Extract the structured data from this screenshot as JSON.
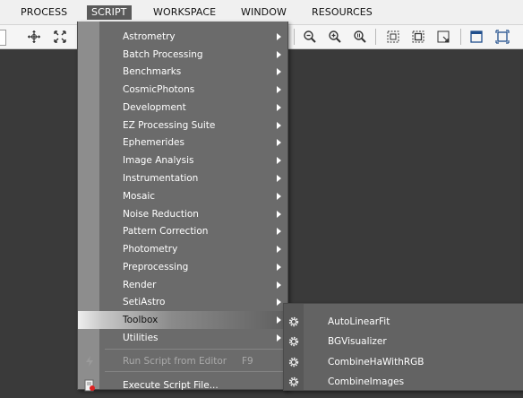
{
  "menubar": {
    "items": [
      "PROCESS",
      "SCRIPT",
      "WORKSPACE",
      "WINDOW",
      "RESOURCES"
    ],
    "active": "SCRIPT"
  },
  "toolbar": {
    "icons": [
      "move-icon",
      "fit-icon",
      "zoom-out-icon",
      "zoom-in-icon",
      "zoom-1to1-icon",
      "select-icon",
      "crop-icon",
      "expand-icon",
      "window-icon",
      "maximize-icon"
    ]
  },
  "script_menu": {
    "items": [
      {
        "label": "Astrometry"
      },
      {
        "label": "Batch Processing"
      },
      {
        "label": "Benchmarks"
      },
      {
        "label": "CosmicPhotons"
      },
      {
        "label": "Development"
      },
      {
        "label": "EZ Processing Suite"
      },
      {
        "label": "Ephemerides"
      },
      {
        "label": "Image Analysis"
      },
      {
        "label": "Instrumentation"
      },
      {
        "label": "Mosaic"
      },
      {
        "label": "Noise Reduction"
      },
      {
        "label": "Pattern Correction"
      },
      {
        "label": "Photometry"
      },
      {
        "label": "Preprocessing"
      },
      {
        "label": "Render"
      },
      {
        "label": "SetiAstro"
      },
      {
        "label": "Toolbox"
      },
      {
        "label": "Utilities"
      }
    ],
    "highlighted": "Toolbox",
    "run_script": {
      "label": "Run Script from Editor",
      "shortcut": "F9"
    },
    "execute_script": {
      "label": "Execute Script File..."
    }
  },
  "toolbox_submenu": {
    "items": [
      {
        "label": "AutoLinearFit"
      },
      {
        "label": "BGVisualizer"
      },
      {
        "label": "CombineHaWithRGB"
      },
      {
        "label": "CombineImages"
      }
    ]
  },
  "colors": {
    "menu_bg": "#6b6b6b",
    "menu_gutter": "#8d8d8d",
    "workspace_bg": "#3a3a3a",
    "submenu_bg": "#636363"
  }
}
